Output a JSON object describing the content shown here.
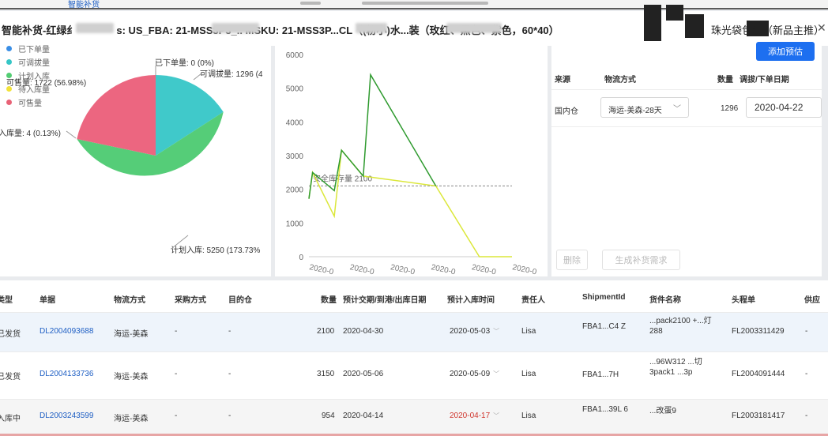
{
  "top_tabs": [
    "...",
    "智能补货"
  ],
  "title": {
    "text": "智能补货-红绿纟",
    "middle": "s: US_FBA:  21-MSS3P3_..  MSKU:  21-MSS3P...CL（(粉小)水...装（玫红、黑色、紫色，60*40）",
    "right": "珠光袋包装（新品主推）"
  },
  "pie": {
    "legend": [
      {
        "label": "已下单量",
        "color": "#3a8ee6"
      },
      {
        "label": "可调拔量",
        "color": "#36c6c6"
      },
      {
        "label": "计划入库",
        "color": "#53cd73"
      },
      {
        "label": "待入库量",
        "color": "#f2e23a"
      },
      {
        "label": "可售量",
        "color": "#e86276"
      }
    ],
    "labels": {
      "ordered": "已下单量: 0 (0%)",
      "transferable": "可调拔量: 1296 (4",
      "sellable": "可售量: 1722 (56.98%)",
      "inbound": "入库量: 4 (0.13%)",
      "planned": "计划入库: 5250 (173.73%"
    }
  },
  "chart_data": {
    "type": "line",
    "y_ticks": [
      "6000",
      "5000",
      "4000",
      "3000",
      "2000",
      "1000",
      "0"
    ],
    "ylim": [
      0,
      6000
    ],
    "x_tick_labels": [
      "2020-0",
      "2020-0",
      "2020-0",
      "2020-0",
      "2020-0",
      "2020-0"
    ],
    "safety_stock_label": "安全库存量 2100",
    "safety_stock": 2100,
    "series": [
      {
        "color": "#2e9a2e",
        "points": [
          [
            0,
            1720
          ],
          [
            0.5,
            2500
          ],
          [
            3.5,
            1960
          ],
          [
            4.5,
            3160
          ],
          [
            7.5,
            2390
          ],
          [
            8.5,
            5400
          ],
          [
            17.5,
            2100
          ]
        ]
      },
      {
        "color": "#dbe73a",
        "points": [
          [
            0,
            1720
          ],
          [
            0.5,
            2500
          ],
          [
            3.5,
            1200
          ],
          [
            4.5,
            3160
          ],
          [
            7.5,
            2390
          ],
          [
            17.5,
            2100
          ],
          [
            23.5,
            0
          ],
          [
            28,
            0
          ]
        ]
      }
    ]
  },
  "source_panel": {
    "add_button": "添加预估",
    "headers": {
      "source": "来源",
      "logistics": "物流方式",
      "qty": "数量",
      "date": "调拔/下单日期"
    },
    "row": {
      "source": "国内仓",
      "logistics": "海运-美森-28天",
      "qty": "1296",
      "date": "2020-04-22"
    },
    "delete_button": "删除",
    "generate_button": "生成补货需求"
  },
  "table": {
    "headers": [
      "类型",
      "单据",
      "物流方式",
      "采购方式",
      "目的仓",
      "数量",
      "预计交期/到港/出库日期",
      "预计入库时间",
      "责任人",
      "ShipmentId",
      "货件名称",
      "头程单",
      "供应"
    ],
    "rows": [
      {
        "type": "已发货",
        "doc": "DL2004093688",
        "logistics": "海运-美森",
        "purchase": "-",
        "dest": "-",
        "qty": "2100",
        "eta": "2020-04-30",
        "arrival": "2020-05-03",
        "owner": "Lisa",
        "shipment": "FBA1...C4 Z",
        "name": "...pack2100 +...灯 288",
        "headship": "FL2003311429",
        "supplier": "-"
      },
      {
        "type": "已发货",
        "doc": "DL2004133736",
        "logistics": "海运-美森",
        "purchase": "-",
        "dest": "-",
        "qty": "3150",
        "eta": "2020-05-06",
        "arrival": "2020-05-09",
        "owner": "Lisa",
        "shipment": "FBA1...7H",
        "name": "...96W312 ...切3pack1 ...3p",
        "headship": "FL2004091444",
        "supplier": "-"
      },
      {
        "type": "入库中",
        "doc": "DL2003243599",
        "logistics": "海运-美森",
        "purchase": "-",
        "dest": "-",
        "qty": "954",
        "eta": "2020-04-14",
        "arrival": "2020-04-17",
        "owner": "Lisa",
        "shipment": "FBA1...39L 6",
        "name": "...改蛋9",
        "headship": "FL2003181417",
        "supplier": "-"
      }
    ]
  },
  "icons": {
    "close": "close-icon",
    "chevron": "chevron-down-icon"
  }
}
